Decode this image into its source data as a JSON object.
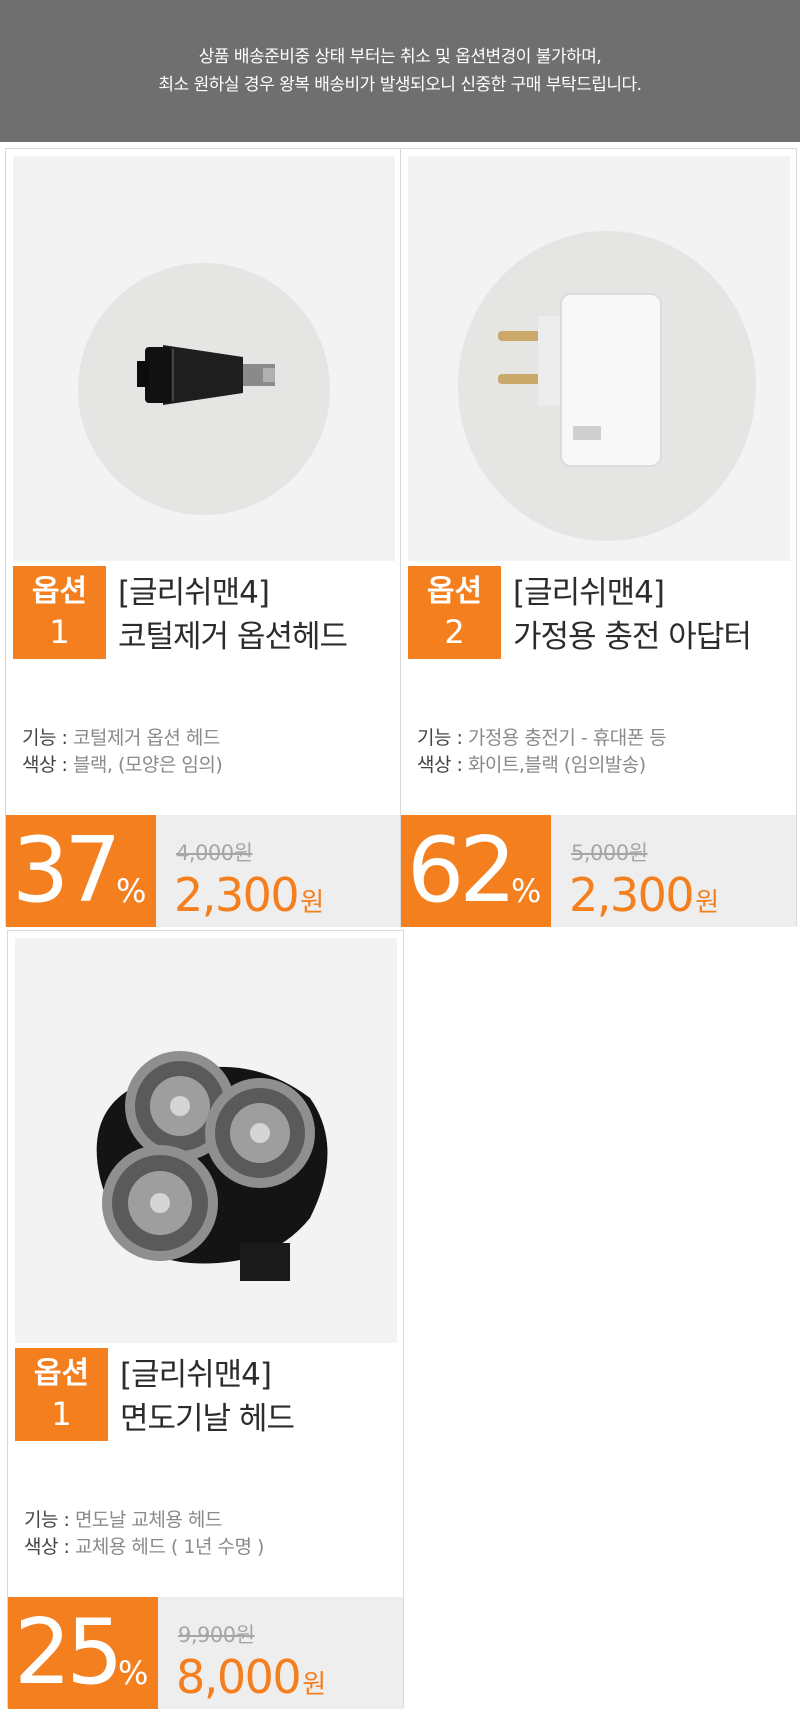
{
  "notice": {
    "line1": "상품 배송준비중 상태 부터는 취소 및 옵션변경이 불가하며,",
    "line2": "최소 원하실 경우 왕복 배송비가 발생되오니 신중한 구매 부탁드립니다."
  },
  "products": [
    {
      "option_label": "옵션",
      "option_num": "1",
      "brand": "[글리쉬맨4]",
      "name": "코털제거 옵션헤드",
      "spec1_label": "기능 : ",
      "spec1_value": "코털제거 옵션 헤드",
      "spec2_label": "색상 : ",
      "spec2_value": "블랙, (모양은 임의)",
      "discount": "37",
      "percent_sign": "%",
      "original_price": "4,000원",
      "sale_price": "2,300",
      "currency": "원",
      "image_icon": "nose-trimmer-head-image"
    },
    {
      "option_label": "옵션",
      "option_num": "2",
      "brand": "[글리쉬맨4]",
      "name": "가정용 충전 아답터",
      "spec1_label": "기능 : ",
      "spec1_value": "가정용 충전기 - 휴대폰 등",
      "spec2_label": "색상 : ",
      "spec2_value": "화이트,블랙 (임의발송)",
      "discount": "62",
      "percent_sign": "%",
      "original_price": "5,000원",
      "sale_price": "2,300",
      "currency": "원",
      "image_icon": "charging-adapter-image"
    },
    {
      "option_label": "옵션",
      "option_num": "1",
      "brand": "[글리쉬맨4]",
      "name": "면도기날 헤드",
      "spec1_label": "기능 : ",
      "spec1_value": "면도날 교체용 헤드",
      "spec2_label": "색상 : ",
      "spec2_value": "교체용 헤드 ( 1년 수명 )",
      "discount": "25",
      "percent_sign": "%",
      "original_price": "9,900원",
      "sale_price": "8,000",
      "currency": "원",
      "image_icon": "shaver-blade-head-image"
    }
  ],
  "colors": {
    "accent": "#f47f1f",
    "notice_bg": "#6f6f6f",
    "price_bg": "#eeeeee"
  }
}
